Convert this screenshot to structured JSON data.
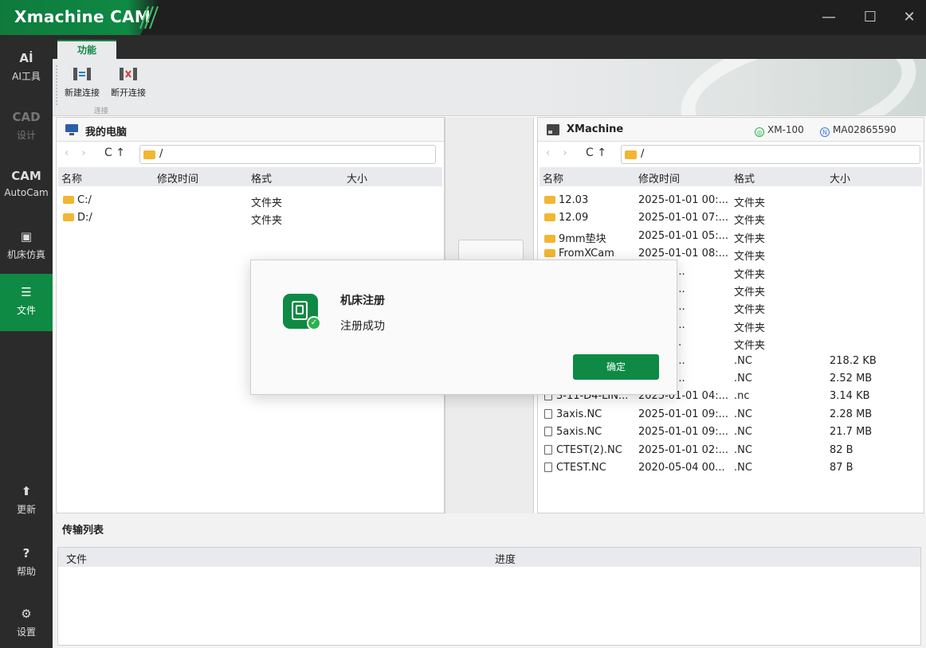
{
  "app": {
    "title": "Xmachine CAM"
  },
  "window_controls": {
    "minimize": "—",
    "maximize": "☐",
    "close": "✕"
  },
  "sidebar": {
    "items": [
      {
        "icon": "Aİ",
        "label": "AI工具"
      },
      {
        "icon": "CAD",
        "label": "设计"
      },
      {
        "icon": "CAM",
        "label": "AutoCam"
      },
      {
        "icon": "▣",
        "label": "机床仿真"
      },
      {
        "icon": "☰",
        "label": "文件"
      },
      {
        "icon": "⬆",
        "label": "更新"
      },
      {
        "icon": "?",
        "label": "帮助"
      },
      {
        "icon": "⚙",
        "label": "设置"
      }
    ]
  },
  "ribbon": {
    "tab": "功能",
    "buttons": [
      {
        "label": "新建连接"
      },
      {
        "label": "断开连接"
      }
    ],
    "group": "连接"
  },
  "local_panel": {
    "title": "我的电脑",
    "path": "/",
    "columns": [
      "名称",
      "修改时间",
      "格式",
      "大小"
    ],
    "rows": [
      {
        "name": "C:/",
        "modified": "",
        "type": "文件夹",
        "size": ""
      },
      {
        "name": "D:/",
        "modified": "",
        "type": "文件夹",
        "size": ""
      }
    ]
  },
  "remote_panel": {
    "title": "XMachine",
    "model_badge": "XM-100",
    "serial_badge": "MA02865590",
    "serial_prefix": "N",
    "path": "/",
    "columns": [
      "名称",
      "修改时间",
      "格式",
      "大小"
    ],
    "rows": [
      {
        "name": "12.03",
        "modified": "2025-01-01 00:...",
        "type": "文件夹",
        "size": "",
        "kind": "folder"
      },
      {
        "name": "12.09",
        "modified": "2025-01-01 07:...",
        "type": "文件夹",
        "size": "",
        "kind": "folder"
      },
      {
        "name": "9mm垫块",
        "modified": "2025-01-01 05:...",
        "type": "文件夹",
        "size": "",
        "kind": "folder"
      },
      {
        "name": "FromXCam",
        "modified": "2025-01-01 08:...",
        "type": "文件夹",
        "size": "",
        "kind": "folder"
      },
      {
        "name": "",
        "modified": "-01 00:...",
        "type": "文件夹",
        "size": "",
        "kind": "hidden"
      },
      {
        "name": "",
        "modified": "-01 00:...",
        "type": "文件夹",
        "size": "",
        "kind": "hidden"
      },
      {
        "name": "",
        "modified": "-01 05:...",
        "type": "文件夹",
        "size": "",
        "kind": "hidden"
      },
      {
        "name": "",
        "modified": "-01 00:...",
        "type": "文件夹",
        "size": "",
        "kind": "hidden"
      },
      {
        "name": "",
        "modified": "-04 00...",
        "type": "文件夹",
        "size": "",
        "kind": "hidden"
      },
      {
        "name": "",
        "modified": "-01 08:...",
        "type": ".NC",
        "size": "218.2 KB",
        "kind": "hidden"
      },
      {
        "name": "",
        "modified": "-01 09:...",
        "type": ".NC",
        "size": "2.52 MB",
        "kind": "hidden"
      },
      {
        "name": "3-11-D4-LIN...",
        "modified": "2025-01-01 04:...",
        "type": ".nc",
        "size": "3.14 KB",
        "kind": "file"
      },
      {
        "name": "3axis.NC",
        "modified": "2025-01-01 09:...",
        "type": ".NC",
        "size": "2.28 MB",
        "kind": "file"
      },
      {
        "name": "5axis.NC",
        "modified": "2025-01-01 09:...",
        "type": ".NC",
        "size": "21.7 MB",
        "kind": "file"
      },
      {
        "name": "CTEST(2).NC",
        "modified": "2025-01-01 02:...",
        "type": ".NC",
        "size": "82 B",
        "kind": "file"
      },
      {
        "name": "CTEST.NC",
        "modified": "2020-05-04 00...",
        "type": ".NC",
        "size": "87 B",
        "kind": "file"
      }
    ]
  },
  "transfer": {
    "title": "传输列表",
    "columns": [
      "文件",
      "进度"
    ]
  },
  "dialog": {
    "title": "机床注册",
    "message": "注册成功",
    "ok_label": "确定",
    "check": "✓"
  },
  "nav": {
    "back": "‹",
    "forward": "›",
    "refresh": "C",
    "up": "↑"
  },
  "colors": {
    "accent": "#0e8a44",
    "folder": "#f2b632"
  }
}
